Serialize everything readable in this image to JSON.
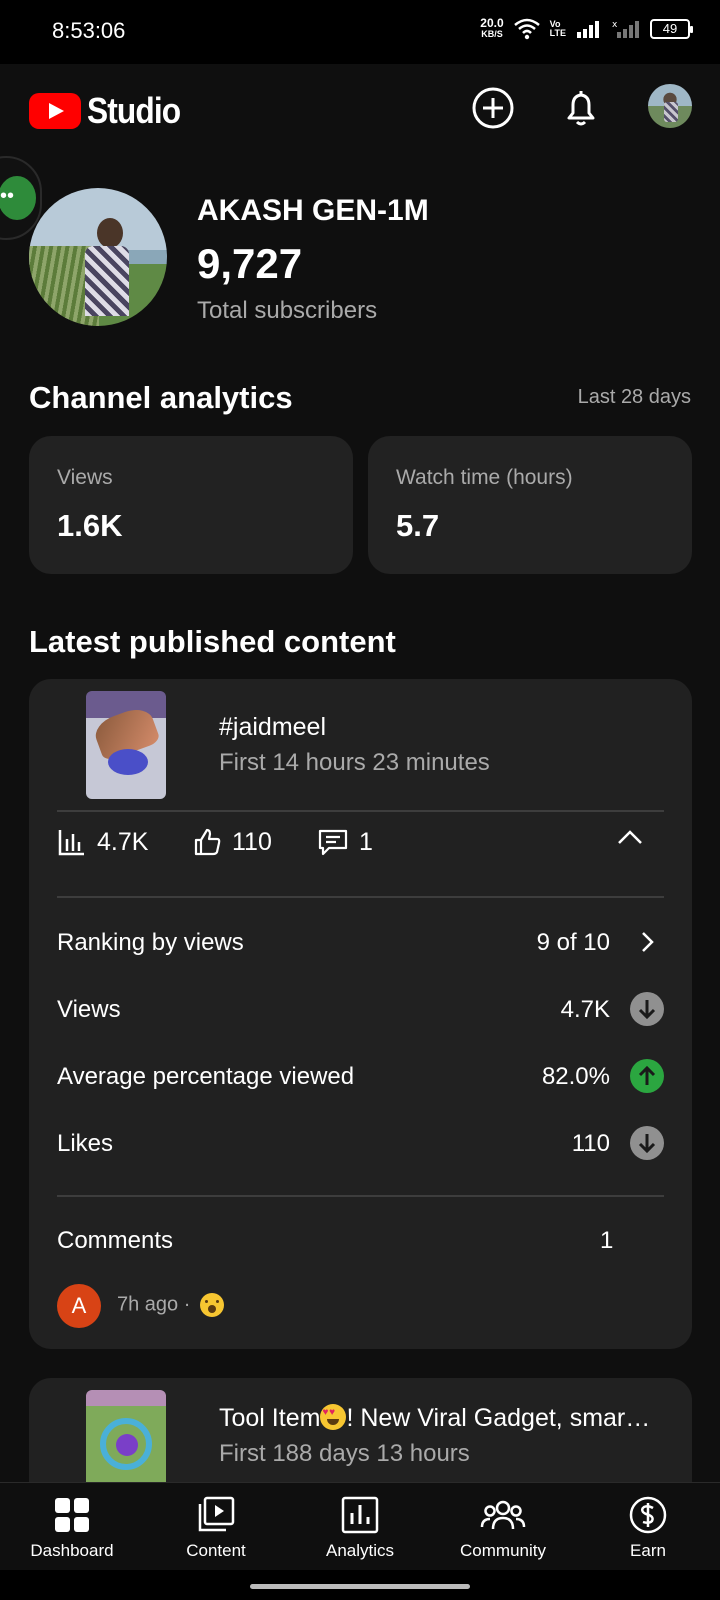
{
  "status_bar": {
    "time": "8:53:06",
    "net_speed": "20.0",
    "net_speed_unit": "KB/S",
    "volte_top": "Vo",
    "volte_bottom": "LTE",
    "battery": "49"
  },
  "header": {
    "logo_text": "Studio",
    "icons": [
      "create-icon",
      "notifications-icon",
      "account-avatar"
    ]
  },
  "profile": {
    "channel_name": "AKASH GEN-1M",
    "subscriber_count": "9,727",
    "subscriber_label": "Total subscribers"
  },
  "analytics": {
    "title": "Channel analytics",
    "period": "Last 28 days",
    "cards": [
      {
        "label": "Views",
        "value": "1.6K"
      },
      {
        "label": "Watch time (hours)",
        "value": "5.7"
      }
    ]
  },
  "latest": {
    "title": "Latest published content",
    "video": {
      "title": "#jaidmeel",
      "subtitle": "First 14 hours 23 minutes",
      "views": "4.7K",
      "likes": "110",
      "comments": "1"
    },
    "rows": [
      {
        "label": "Ranking by views",
        "value": "9 of 10",
        "icon": "chevron-right-icon"
      },
      {
        "label": "Views",
        "value": "4.7K",
        "icon": "arrow-down-icon"
      },
      {
        "label": "Average percentage viewed",
        "value": "82.0%",
        "icon": "arrow-up-icon"
      },
      {
        "label": "Likes",
        "value": "110",
        "icon": "arrow-down-icon"
      }
    ],
    "comments_label": "Comments",
    "comments_count": "1",
    "comment": {
      "initial": "A",
      "time": "7h ago ·"
    },
    "colors": {
      "up": "#2ba640",
      "down": "#909090",
      "comment_avatar": "#d84315"
    }
  },
  "second_video": {
    "title_prefix": "Tool Item",
    "title_suffix": "! New Viral Gadget, smar…",
    "subtitle": "First 188 days 13 hours"
  },
  "bottom_nav": [
    {
      "label": "Dashboard",
      "icon": "dashboard-icon"
    },
    {
      "label": "Content",
      "icon": "content-icon"
    },
    {
      "label": "Analytics",
      "icon": "analytics-icon"
    },
    {
      "label": "Community",
      "icon": "community-icon"
    },
    {
      "label": "Earn",
      "icon": "earn-icon"
    }
  ]
}
